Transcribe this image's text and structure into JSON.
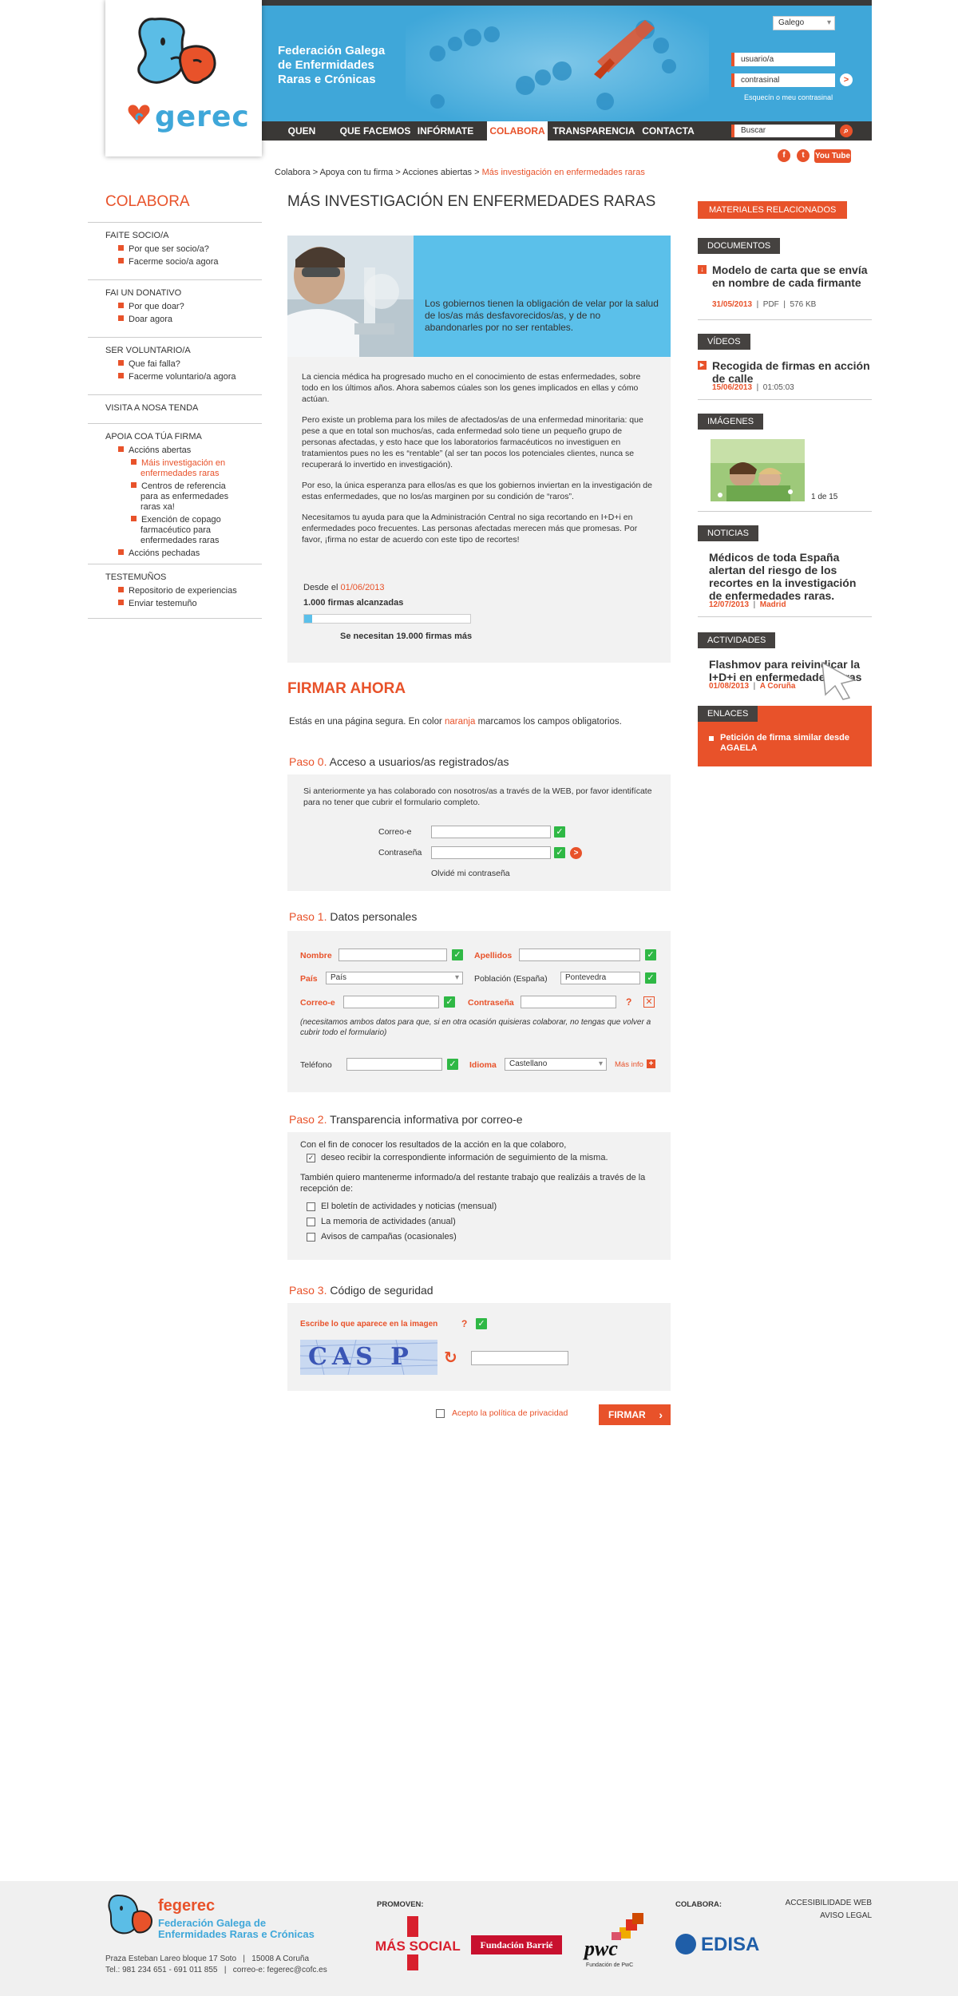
{
  "header": {
    "logo_text": "gerec",
    "org_name_lines": [
      "Federación Galega",
      "de Enfermidades",
      "Raras e Crónicas"
    ],
    "language": "Galego",
    "user_placeholder": "usuario/a",
    "pass_placeholder": "contrasinal",
    "forgot_pass": "Esquecín o meu contrasinal",
    "search_placeholder": "Buscar",
    "youtube": "You Tube"
  },
  "nav": [
    "QUEN SOMOS",
    "QUE FACEMOS",
    "INFÓRMATE",
    "COLABORA",
    "TRANSPARENCIA",
    "CONTACTA"
  ],
  "breadcrumb": {
    "items": [
      "Colabora",
      "Apoya con tu firma",
      "Acciones abiertas"
    ],
    "current": "Más investigación en enfermedades raras",
    "sep": " > "
  },
  "sidebar": {
    "title": "COLABORA",
    "sections": [
      {
        "title": "FAITE SOCIO/A",
        "items": [
          "Por que ser socio/a?",
          "Facerme socio/a agora"
        ]
      },
      {
        "title": "FAI UN DONATIVO",
        "items": [
          "Por que doar?",
          "Doar agora"
        ]
      },
      {
        "title": "SER VOLUNTARIO/A",
        "items": [
          "Que fai falla?",
          "Facerme voluntario/a agora"
        ]
      },
      {
        "title": "VISITA A NOSA TENDA",
        "items": []
      },
      {
        "title": "APOIA COA TÚA FIRMA",
        "items": [
          "Accións abertas",
          "Máis investigación en enfermedades raras",
          "Centros de referencia para as enfermedades raras xa!",
          "Exención de copago farmacéutico para enfermedades raras",
          "Accións pechadas"
        ]
      },
      {
        "title": "TESTEMUÑOS",
        "items": [
          "Repositorio de experiencias",
          "Enviar testemuño"
        ]
      }
    ]
  },
  "main": {
    "title": "MÁS INVESTIGACIÓN EN ENFERMEDADES RARAS",
    "hero_text": "Los gobiernos tienen la obligación de velar por la salud de los/as más desfavorecidos/as, y de no abandonarles por no ser rentables.",
    "paragraphs": [
      "La ciencia médica ha progresado mucho en el conocimiento de estas enfermedades, sobre todo en los últimos años. Ahora sabemos cúales son los genes implicados en ellas y cómo actúan.",
      "Pero existe un problema para los miles de afectados/as de una enfermedad minoritaria: que pese a que en total son muchos/as, cada enfermedad solo tiene un pequeño grupo de personas afectadas, y esto hace que los laboratorios farmacéuticos no investiguen en tratamientos pues no les es “rentable” (al ser tan pocos los potenciales clientes, nunca se recuperará lo invertido en investigación).",
      "Por eso, la única esperanza para ellos/as es que los gobiernos inviertan en la investigación de estas enfermedades, que no los/as marginen por su condición de “raros”.",
      "Necesitamos tu ayuda para que la Administración Central no siga recortando en I+D+i en enfermedades poco frecuentes. Las personas afectadas merecen más que promesas. Por favor, ¡firma no estar de acuerdo con este tipo de recortes!"
    ],
    "since_label": "Desde el",
    "since_date": "01/06/2013",
    "signatures": "1.000 firmas alcanzadas",
    "progress": 0.05,
    "needed": "Se necesitan 19.000 firmas más"
  },
  "form": {
    "title": "FIRMAR AHORA",
    "intro_a": "Estás en una página segura. En color",
    "intro_orange": "naranja",
    "intro_b": "marcamos los campos obligatorios.",
    "step0": {
      "num": "Paso 0.",
      "title": "Acceso a usuarios/as registrados/as",
      "text": "Si anteriormente ya has colaborado con nosotros/as a través de la WEB, por favor identifícate para no tener que cubrir el formulario completo.",
      "email_label": "Correo-e",
      "pass_label": "Contraseña",
      "forgot": "Olvidé mi contraseña"
    },
    "step1": {
      "num": "Paso 1.",
      "title": "Datos personales",
      "nombre": "Nombre",
      "apellidos": "Apellidos",
      "pais": "País",
      "pais_value": "País",
      "poblacion": "Población (España)",
      "poblacion_value": "Pontevedra",
      "correo": "Correo-e",
      "contrasena": "Contraseña",
      "note": "(necesitamos ambos datos para que, si en otra ocasión quisieras colaborar, no tengas que volver a cubrir todo el formulario)",
      "telefono": "Teléfono",
      "idioma": "Idioma",
      "idioma_value": "Castellano",
      "mas_info": "Más info"
    },
    "step2": {
      "num": "Paso 2.",
      "title": "Transparencia informativa por correo-e",
      "text1": "Con el fin de conocer los resultados de la acción en la que colaboro,",
      "opt1": "deseo recibir la correspondiente información de seguimiento de la misma.",
      "text2": "También quiero mantenerme informado/a del restante trabajo que realizáis a través de la recepción de:",
      "opts": [
        "El boletín de actividades y noticias (mensual)",
        "La memoria de actividades (anual)",
        "Avisos de campañas (ocasionales)"
      ]
    },
    "step3": {
      "num": "Paso 3.",
      "title": "Código de seguridad",
      "label": "Escribe lo que aparece en la imagen",
      "captcha": "CAS P"
    },
    "privacy": "Acepto la política de privacidad",
    "submit": "FIRMAR"
  },
  "right": {
    "related": "MATERIALES RELACIONADOS",
    "documentos": {
      "tag": "DOCUMENTOS",
      "title": "Modelo de carta que se envía en nombre de cada firmante",
      "date": "31/05/2013",
      "type": "PDF",
      "size": "576 KB"
    },
    "videos": {
      "tag": "VÍDEOS",
      "title": "Recogida de firmas en acción de calle",
      "date": "15/06/2013",
      "duration": "01:05:03"
    },
    "imagenes": {
      "tag": "IMÁGENES",
      "counter": "1 de 15"
    },
    "noticias": {
      "tag": "NOTICIAS",
      "title": "Médicos de toda España alertan del riesgo de los recortes en la investigación de enfermedades raras.",
      "date": "12/07/2013",
      "place": "Madrid"
    },
    "actividades": {
      "tag": "ACTIVIDADES",
      "title": "Flashmov para reivindicar la I+D+i en enfermedades raras",
      "date": "01/08/2013",
      "place": "A Coruña"
    },
    "enlaces": {
      "tag": "ENLACES",
      "link": "Petición de firma similar desde AGAELA"
    }
  },
  "footer": {
    "logo_name": "fegerec",
    "org_lines": [
      "Federación Galega de",
      "Enfermidades Raras e Crónicas"
    ],
    "address": "Praza Esteban Lareo bloque 17 Soto   |   15008 A Coruña",
    "contact": "Tel.: 981 234 651 - 691 011 855   |   correo-e: fegerec@cofc.es",
    "promoven": "PROMOVEN:",
    "mas_social": "MÁS SOCIAL",
    "barrie": "Fundación Barrié",
    "pwc": "pwc",
    "pwc_sub": "Fundación de PwC",
    "colabora": "COLABORA:",
    "edisa": "EDISA",
    "links": [
      "ACCESIBILIDADE WEB",
      "AVISO LEGAL"
    ]
  },
  "colors": {
    "accent": "#e8522a",
    "blue": "#3fa7d9",
    "dark": "#3a3836",
    "green": "#2fb845"
  }
}
